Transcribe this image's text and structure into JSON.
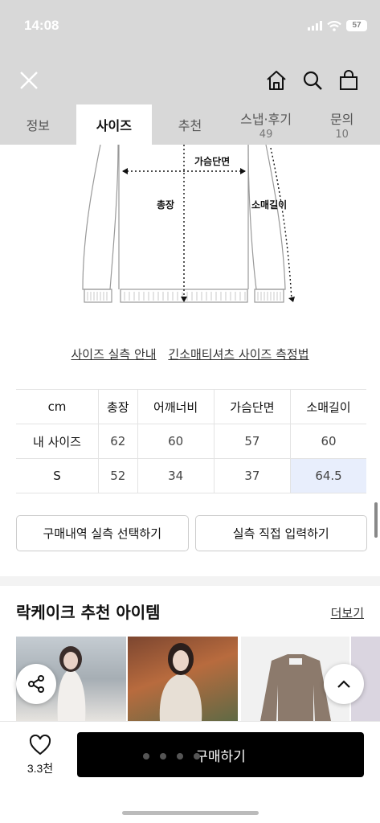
{
  "status_bar": {
    "time": "14:08",
    "battery": "57"
  },
  "nav": {
    "icons": [
      "close-icon",
      "home-icon",
      "search-icon",
      "shopping-bag-icon"
    ]
  },
  "tabs": [
    {
      "label": "정보",
      "count": ""
    },
    {
      "label": "사이즈",
      "count": ""
    },
    {
      "label": "추천",
      "count": ""
    },
    {
      "label": "스냅·후기",
      "count": "49"
    },
    {
      "label": "문의",
      "count": "10"
    }
  ],
  "diagram": {
    "chest_label": "가슴단면",
    "length_label": "총장",
    "sleeve_label": "소매길이"
  },
  "links": {
    "guide": "사이즈 실측 안내",
    "measure": "긴소매티셔츠 사이즈 측정법"
  },
  "size_table": {
    "headers": [
      "cm",
      "총장",
      "어깨너비",
      "가슴단면",
      "소매길이"
    ],
    "rows": [
      [
        "내 사이즈",
        "62",
        "60",
        "57",
        "60"
      ],
      [
        "S",
        "52",
        "34",
        "37",
        "64.5"
      ]
    ],
    "highlight_color": "#e8eefc"
  },
  "buttons": {
    "select_history": "구매내역 실측 선택하기",
    "direct_input": "실측 직접 입력하기"
  },
  "recommend": {
    "title": "락케이크 추천 아이템",
    "more": "더보기"
  },
  "bottom": {
    "like_count": "3.3천",
    "buy_label": "구매하기"
  }
}
